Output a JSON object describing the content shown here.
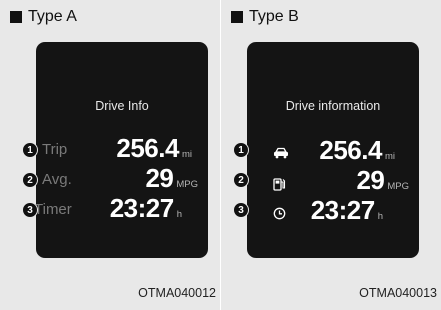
{
  "type_a": {
    "heading": "Type A",
    "screen_title": "Drive Info",
    "rows": [
      {
        "label": "Trip",
        "value": "256.4",
        "unit": "mi"
      },
      {
        "label": "Avg.",
        "value": "29",
        "unit": "MPG"
      },
      {
        "label": "Timer",
        "value": "23:27",
        "unit": "h"
      }
    ],
    "code": "OTMA040012"
  },
  "type_b": {
    "heading": "Type B",
    "screen_title": "Drive information",
    "rows": [
      {
        "icon": "car-icon",
        "value": "256.4",
        "unit": "mi"
      },
      {
        "icon": "fuel-pump-icon",
        "value": "29",
        "unit": "MPG"
      },
      {
        "icon": "clock-icon",
        "value": "23:27",
        "unit": "h"
      }
    ],
    "code": "OTMA040013"
  },
  "markers": [
    "1",
    "2",
    "3"
  ]
}
